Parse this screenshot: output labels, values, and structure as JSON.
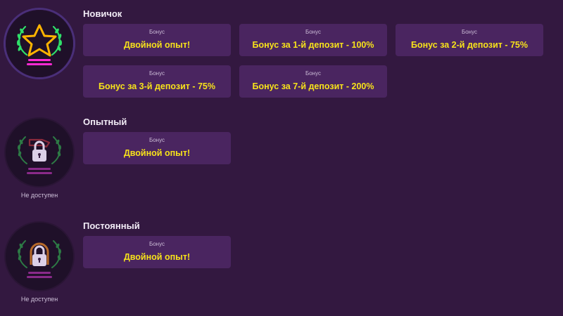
{
  "levels": [
    {
      "title": "Новичок",
      "status": "",
      "bonuses": [
        {
          "caption": "Бонус",
          "value": "Двойной опыт!"
        },
        {
          "caption": "Бонус",
          "value": "Бонус за 1-й депозит - 100%"
        },
        {
          "caption": "Бонус",
          "value": "Бонус за 2-й депозит - 75%"
        },
        {
          "caption": "Бонус",
          "value": "Бонус за 3-й депозит - 75%"
        },
        {
          "caption": "Бонус",
          "value": "Бонус за 7-й депозит - 200%"
        }
      ]
    },
    {
      "title": "Опытный",
      "status": "Не доступен",
      "bonuses": [
        {
          "caption": "Бонус",
          "value": "Двойной опыт!"
        }
      ]
    },
    {
      "title": "Постоянный",
      "status": "Не доступен",
      "bonuses": [
        {
          "caption": "Бонус",
          "value": "Двойной опыт!"
        }
      ]
    }
  ],
  "icons": {
    "level_1": "star-laurel-icon",
    "level_2": "key-laurel-lock-icon",
    "level_3": "horseshoe-laurel-lock-icon"
  },
  "colors": {
    "background": "#331840",
    "card": "#4a2560",
    "bonus_text": "#f7e21a",
    "laurel_active": "#2fe06a",
    "star": "#ffb400",
    "neon_pink": "#ff2ad4"
  }
}
